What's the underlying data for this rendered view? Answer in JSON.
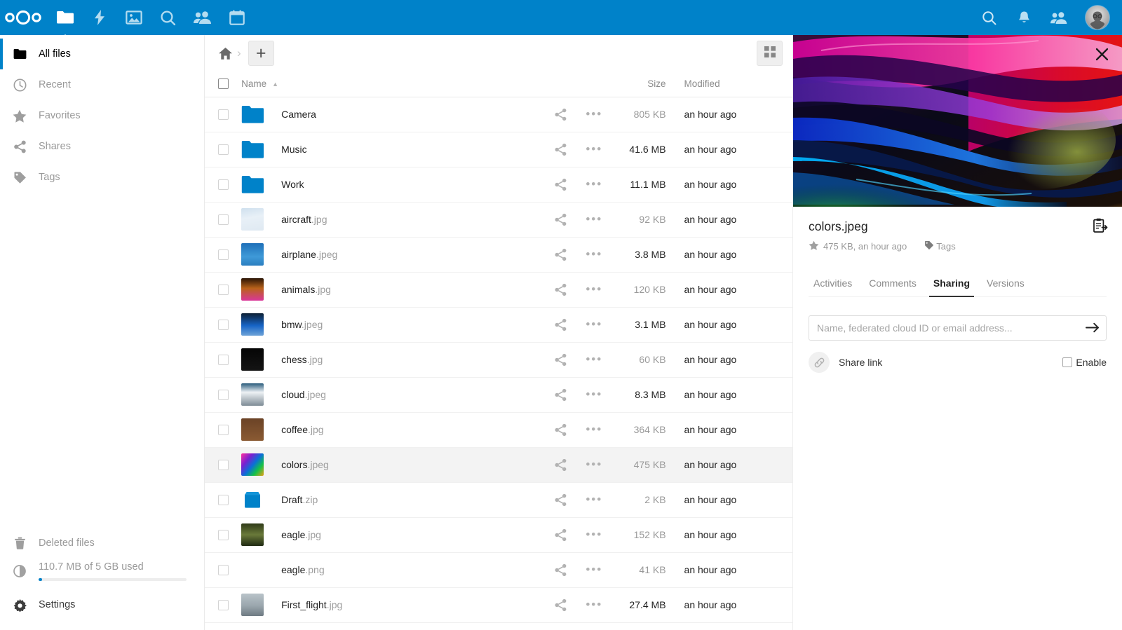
{
  "header": {
    "logo_name": "nextcloud-logo",
    "apps": [
      {
        "id": "files",
        "icon": "folder-icon",
        "label": "Files",
        "active": true
      },
      {
        "id": "activity",
        "icon": "lightning-icon",
        "label": "Activity",
        "active": false
      },
      {
        "id": "photos",
        "icon": "image-icon",
        "label": "Photos",
        "active": false
      },
      {
        "id": "search",
        "icon": "magnifier-app-icon",
        "label": "Search",
        "active": false
      },
      {
        "id": "contacts",
        "icon": "contacts-icon",
        "label": "Contacts",
        "active": false
      },
      {
        "id": "calendar",
        "icon": "calendar-icon",
        "label": "Calendar",
        "active": false
      }
    ],
    "right_icons": [
      {
        "id": "search",
        "icon": "search-icon",
        "label": "Search"
      },
      {
        "id": "notifications",
        "icon": "bell-icon",
        "label": "Notifications"
      },
      {
        "id": "contacts-menu",
        "icon": "contacts-menu-icon",
        "label": "Contacts"
      }
    ],
    "avatar_name": "user-avatar"
  },
  "sidebar": {
    "items": [
      {
        "label": "All files",
        "icon": "folder-icon",
        "active": true
      },
      {
        "label": "Recent",
        "icon": "clock-icon",
        "active": false
      },
      {
        "label": "Favorites",
        "icon": "star-icon",
        "active": false
      },
      {
        "label": "Shares",
        "icon": "share-icon",
        "active": false
      },
      {
        "label": "Tags",
        "icon": "tag-icon",
        "active": false
      }
    ],
    "deleted_files": {
      "label": "Deleted files",
      "icon": "trash-icon"
    },
    "quota": {
      "label": "110.7 MB of 5 GB used",
      "icon": "pie-chart-icon",
      "percent": 2.2
    },
    "settings": {
      "label": "Settings",
      "icon": "gear-icon"
    }
  },
  "toolbar": {
    "home_icon": "home-icon",
    "breadcrumb_separator": "›",
    "new_button_label": "+",
    "grid_view_icon": "grid-view-icon"
  },
  "filelist": {
    "columns": {
      "name": "Name",
      "size": "Size",
      "modified": "Modified",
      "sort_arrow": "▲"
    },
    "rows": [
      {
        "base": "Camera",
        "ext": "",
        "type": "folder",
        "size": "805 KB",
        "modified": "an hour ago",
        "selected": false,
        "size_dim": true
      },
      {
        "base": "Music",
        "ext": "",
        "type": "folder",
        "size": "41.6 MB",
        "modified": "an hour ago",
        "selected": false,
        "size_dim": false
      },
      {
        "base": "Work",
        "ext": "",
        "type": "folder",
        "size": "11.1 MB",
        "modified": "an hour ago",
        "selected": false,
        "size_dim": false
      },
      {
        "base": "aircraft",
        "ext": ".jpg",
        "type": "image",
        "size": "92 KB",
        "modified": "an hour ago",
        "selected": false,
        "size_dim": true
      },
      {
        "base": "airplane",
        "ext": ".jpeg",
        "type": "image",
        "size": "3.8 MB",
        "modified": "an hour ago",
        "selected": false,
        "size_dim": false
      },
      {
        "base": "animals",
        "ext": ".jpg",
        "type": "image",
        "size": "120 KB",
        "modified": "an hour ago",
        "selected": false,
        "size_dim": true
      },
      {
        "base": "bmw",
        "ext": ".jpeg",
        "type": "image",
        "size": "3.1 MB",
        "modified": "an hour ago",
        "selected": false,
        "size_dim": false
      },
      {
        "base": "chess",
        "ext": ".jpg",
        "type": "image",
        "size": "60 KB",
        "modified": "an hour ago",
        "selected": false,
        "size_dim": true
      },
      {
        "base": "cloud",
        "ext": ".jpeg",
        "type": "image",
        "size": "8.3 MB",
        "modified": "an hour ago",
        "selected": false,
        "size_dim": false
      },
      {
        "base": "coffee",
        "ext": ".jpg",
        "type": "image",
        "size": "364 KB",
        "modified": "an hour ago",
        "selected": false,
        "size_dim": true
      },
      {
        "base": "colors",
        "ext": ".jpeg",
        "type": "image",
        "size": "475 KB",
        "modified": "an hour ago",
        "selected": true,
        "size_dim": true
      },
      {
        "base": "Draft",
        "ext": ".zip",
        "type": "zip",
        "size": "2 KB",
        "modified": "an hour ago",
        "selected": false,
        "size_dim": true
      },
      {
        "base": "eagle",
        "ext": ".jpg",
        "type": "image",
        "size": "152 KB",
        "modified": "an hour ago",
        "selected": false,
        "size_dim": true
      },
      {
        "base": "eagle",
        "ext": ".png",
        "type": "image",
        "size": "41 KB",
        "modified": "an hour ago",
        "selected": false,
        "size_dim": true
      },
      {
        "base": "First_flight",
        "ext": ".jpg",
        "type": "image",
        "size": "27.4 MB",
        "modified": "an hour ago",
        "selected": false,
        "size_dim": false
      }
    ],
    "row_icons": {
      "share": "share-icon",
      "actions": "more-actions-icon",
      "checkbox": "row-checkbox"
    }
  },
  "panel": {
    "close_icon": "close-icon",
    "preview_name": "file-preview-image",
    "title": "colors.jpeg",
    "favorite_icon": "star-icon",
    "meta": "475 KB, an hour ago",
    "tags_label": "Tags",
    "tags_icon": "tag-icon",
    "action_icon": "move-copy-icon",
    "tabs": [
      {
        "label": "Activities",
        "active": false
      },
      {
        "label": "Comments",
        "active": false
      },
      {
        "label": "Sharing",
        "active": true
      },
      {
        "label": "Versions",
        "active": false
      }
    ],
    "share_input_placeholder": "Name, federated cloud ID or email address...",
    "share_input_value": "",
    "submit_icon": "arrow-right-icon",
    "share_link_label": "Share link",
    "share_link_icon": "link-icon",
    "enable_label": "Enable",
    "enable_checked": false
  },
  "colors": {
    "brand_blue": "#0082c9",
    "folder_blue": "#0082c9",
    "selected_row": "#f3f3f3",
    "text_primary": "#222222",
    "text_muted": "#9a9a9a"
  }
}
